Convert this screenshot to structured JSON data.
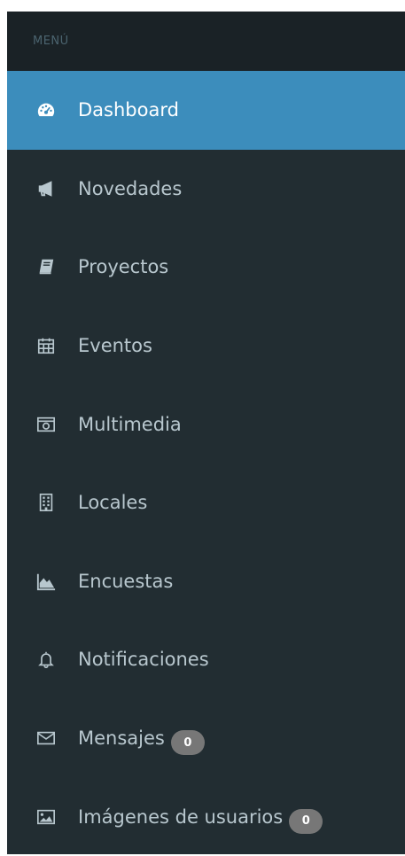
{
  "menu": {
    "header": "MENÚ",
    "items": [
      {
        "label": "Dashboard",
        "icon": "dashboard-icon",
        "active": true
      },
      {
        "label": "Novedades",
        "icon": "megaphone-icon"
      },
      {
        "label": "Proyectos",
        "icon": "book-icon"
      },
      {
        "label": "Eventos",
        "icon": "calendar-icon"
      },
      {
        "label": "Multimedia",
        "icon": "camera-icon"
      },
      {
        "label": "Locales",
        "icon": "building-icon"
      },
      {
        "label": "Encuestas",
        "icon": "area-chart-icon"
      },
      {
        "label": "Notificaciones",
        "icon": "bell-icon"
      },
      {
        "label": "Mensajes",
        "icon": "envelope-icon",
        "badge": "0"
      },
      {
        "label": "Imágenes de usuarios",
        "icon": "image-icon",
        "badge": "0"
      }
    ]
  },
  "colors": {
    "sidebar_bg": "#222d32",
    "header_bg": "#1a2226",
    "active_bg": "#3c8dbc",
    "text": "#b8c7ce",
    "badge_bg": "#777777"
  }
}
